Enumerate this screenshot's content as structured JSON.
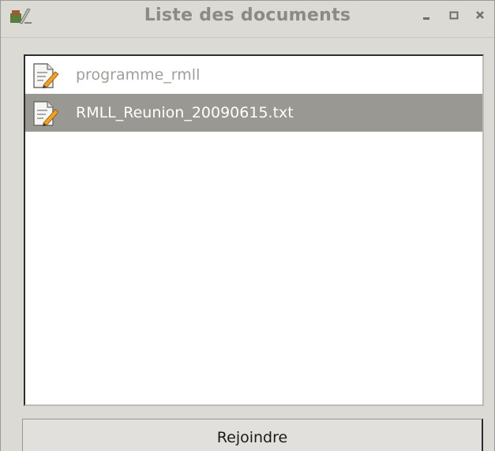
{
  "window": {
    "title": "Liste des documents",
    "app_icon": "app-logo-icon",
    "controls": [
      {
        "name": "minimize",
        "icon": "minimize-icon"
      },
      {
        "name": "maximize",
        "icon": "maximize-icon"
      },
      {
        "name": "close",
        "icon": "close-icon"
      }
    ]
  },
  "documents": [
    {
      "label": "programme_rmll",
      "icon": "text-document-edit-icon",
      "selected": false
    },
    {
      "label": "RMLL_Reunion_20090615.txt",
      "icon": "text-document-edit-icon",
      "selected": true
    }
  ],
  "actions": {
    "join_label": "Rejoindre"
  },
  "colors": {
    "window_bg": "#dcdad5",
    "selection_bg": "#999893",
    "muted_text": "#9e9e9a",
    "title_text": "#8a8a86"
  }
}
